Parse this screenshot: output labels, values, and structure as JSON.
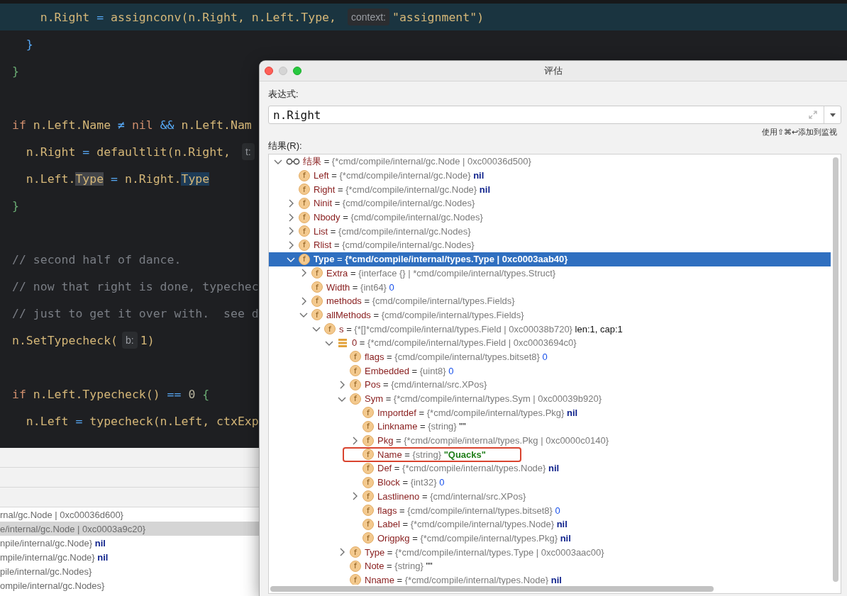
{
  "editor": {
    "lines": [
      {
        "kind": "code",
        "current": true,
        "segments": [
          {
            "text": "    n.Right ",
            "kind": "plain"
          },
          {
            "text": "= ",
            "kind": "op"
          },
          {
            "text": "assignconv(n.Right, n.Left.Type, ",
            "kind": "plain"
          },
          {
            "text": "context:",
            "kind": "hint"
          },
          {
            "text": "\"assignment\"",
            "kind": "string"
          },
          {
            "text": ")",
            "kind": "plain"
          }
        ]
      },
      {
        "kind": "code",
        "current": false,
        "segments": [
          {
            "text": "  }",
            "kind": "brace-inner"
          }
        ]
      },
      {
        "kind": "code",
        "current": false,
        "segments": [
          {
            "text": "}",
            "kind": "brace-outer"
          }
        ]
      },
      {
        "kind": "blank",
        "current": false
      },
      {
        "kind": "code",
        "current": false,
        "segments": [
          {
            "text": "if",
            "kind": "keyword"
          },
          {
            "text": " n.Left.Name ",
            "kind": "plain"
          },
          {
            "text": "≠ ",
            "kind": "op"
          },
          {
            "text": "nil ",
            "kind": "keyword"
          },
          {
            "text": "&& ",
            "kind": "op"
          },
          {
            "text": "n.Left.Nam",
            "kind": "plain"
          }
        ]
      },
      {
        "kind": "code",
        "current": false,
        "segments": [
          {
            "text": "  n.Right ",
            "kind": "plain"
          },
          {
            "text": "= ",
            "kind": "op"
          },
          {
            "text": "defaultlit(n.Right, ",
            "kind": "plain"
          },
          {
            "text": "t:",
            "kind": "hint"
          }
        ]
      },
      {
        "kind": "code",
        "current": false,
        "segments": [
          {
            "text": "  n.Left.",
            "kind": "plain"
          },
          {
            "text": "Type",
            "kind": "read-usage"
          },
          {
            "text": " = ",
            "kind": "op"
          },
          {
            "text": "n.Right.",
            "kind": "plain"
          },
          {
            "text": "Type",
            "kind": "write-usage"
          }
        ]
      },
      {
        "kind": "code",
        "current": false,
        "segments": [
          {
            "text": "}",
            "kind": "brace-outer"
          }
        ]
      },
      {
        "kind": "blank",
        "current": false
      },
      {
        "kind": "code",
        "current": false,
        "segments": [
          {
            "text": "// second half of dance.",
            "kind": "comment"
          }
        ]
      },
      {
        "kind": "code",
        "current": false,
        "segments": [
          {
            "text": "// now that right is done, typechec",
            "kind": "comment"
          }
        ]
      },
      {
        "kind": "code",
        "current": false,
        "segments": [
          {
            "text": "// just to get it over with.  see d",
            "kind": "comment"
          }
        ]
      },
      {
        "kind": "code",
        "current": false,
        "segments": [
          {
            "text": "n.SetTypecheck(",
            "kind": "plain"
          },
          {
            "text": "b:",
            "kind": "hint"
          },
          {
            "text": "1)",
            "kind": "plain"
          }
        ]
      },
      {
        "kind": "blank",
        "current": false
      },
      {
        "kind": "code",
        "current": false,
        "segments": [
          {
            "text": "if",
            "kind": "keyword"
          },
          {
            "text": " n.Left.Typecheck() ",
            "kind": "plain"
          },
          {
            "text": "== ",
            "kind": "op"
          },
          {
            "text": "0 ",
            "kind": "number"
          },
          {
            "text": "{",
            "kind": "brace-outer"
          }
        ]
      },
      {
        "kind": "code",
        "current": false,
        "segments": [
          {
            "text": "  n.Left ",
            "kind": "plain"
          },
          {
            "text": "= ",
            "kind": "op"
          },
          {
            "text": "typecheck(n.Left, ctxExp",
            "kind": "plain"
          }
        ]
      }
    ]
  },
  "variables_panel": {
    "rows": [
      {
        "text": "rnal/gc.Node | 0xc00036d600}",
        "selected": false
      },
      {
        "text": "e/internal/gc.Node | 0xc0003a9c20}",
        "selected": true
      },
      {
        "text": "npile/internal/gc.Node} ",
        "value": "nil",
        "selected": false
      },
      {
        "text": "mpile/internal/gc.Node} ",
        "value": "nil",
        "selected": false
      },
      {
        "text": "pile/internal/gc.Nodes}",
        "selected": false
      },
      {
        "text": "ompile/internal/gc.Nodes}",
        "selected": false
      }
    ]
  },
  "dialog": {
    "title": "评估",
    "window_buttons": [
      {
        "kind": "close",
        "disabled": false
      },
      {
        "kind": "minimize",
        "disabled": true
      },
      {
        "kind": "zoom",
        "disabled": false
      }
    ],
    "expression_label": "表达式:",
    "expression": "n.Right",
    "shortcut_hint": "使用⇧⌘↩添加到监视",
    "result_label": "结果(R):",
    "tree": {
      "nodes": [
        {
          "kind": "root",
          "name": "结果",
          "eq": "=",
          "type": "{*cmd/compile/internal/gc.Node | 0xc00036d500}",
          "expanded": true,
          "selected": false,
          "children": [
            {
              "kind": "field",
              "badge": "f",
              "name": "Left",
              "eq": "=",
              "type": "{*cmd/compile/internal/gc.Node}",
              "value": {
                "text": "nil",
                "kind": "nil"
              },
              "selected": false
            },
            {
              "kind": "field",
              "badge": "f",
              "name": "Right",
              "eq": "=",
              "type": "{*cmd/compile/internal/gc.Node}",
              "value": {
                "text": "nil",
                "kind": "nil"
              },
              "selected": false
            },
            {
              "kind": "field",
              "badge": "f",
              "name": "Ninit",
              "eq": "=",
              "type": "{cmd/compile/internal/gc.Nodes}",
              "expanded": false,
              "selected": false
            },
            {
              "kind": "field",
              "badge": "f",
              "name": "Nbody",
              "eq": "=",
              "type": "{cmd/compile/internal/gc.Nodes}",
              "expanded": false,
              "selected": false
            },
            {
              "kind": "field",
              "badge": "f",
              "name": "List",
              "eq": "=",
              "type": "{cmd/compile/internal/gc.Nodes}",
              "expanded": false,
              "selected": false
            },
            {
              "kind": "field",
              "badge": "f",
              "name": "Rlist",
              "eq": "=",
              "type": "{cmd/compile/internal/gc.Nodes}",
              "expanded": false,
              "selected": false
            },
            {
              "kind": "field",
              "badge": "f",
              "name": "Type",
              "eq": "=",
              "type": "{*cmd/compile/internal/types.Type | 0xc0003aab40}",
              "expanded": true,
              "selected": true,
              "children": [
                {
                  "kind": "field",
                  "badge": "f",
                  "name": "Extra",
                  "eq": "=",
                  "type": "{interface {} | *cmd/compile/internal/types.Struct}",
                  "expanded": false,
                  "selected": false
                },
                {
                  "kind": "field",
                  "badge": "f",
                  "name": "Width",
                  "eq": "=",
                  "type": "{int64}",
                  "value": {
                    "text": "0",
                    "kind": "number"
                  },
                  "selected": false
                },
                {
                  "kind": "field",
                  "badge": "f",
                  "name": "methods",
                  "eq": "=",
                  "type": "{cmd/compile/internal/types.Fields}",
                  "expanded": false,
                  "selected": false
                },
                {
                  "kind": "field",
                  "badge": "f",
                  "name": "allMethods",
                  "eq": "=",
                  "type": "{cmd/compile/internal/types.Fields}",
                  "expanded": true,
                  "selected": false,
                  "children": [
                    {
                      "kind": "field",
                      "badge": "f",
                      "name": "s",
                      "eq": "=",
                      "type": "{*[]*cmd/compile/internal/types.Field | 0xc00038b720}",
                      "value": {
                        "text": "len:1, cap:1",
                        "kind": "text"
                      },
                      "expanded": true,
                      "selected": false,
                      "children": [
                        {
                          "kind": "element",
                          "name": "0",
                          "eq": "=",
                          "type": "{*cmd/compile/internal/types.Field | 0xc0003694c0}",
                          "expanded": true,
                          "selected": false,
                          "children": [
                            {
                              "kind": "field",
                              "badge": "f",
                              "name": "flags",
                              "eq": "=",
                              "type": "{cmd/compile/internal/types.bitset8}",
                              "value": {
                                "text": "0",
                                "kind": "number"
                              },
                              "selected": false
                            },
                            {
                              "kind": "field",
                              "badge": "f",
                              "name": "Embedded",
                              "eq": "=",
                              "type": "{uint8}",
                              "value": {
                                "text": "0",
                                "kind": "number"
                              },
                              "selected": false
                            },
                            {
                              "kind": "field",
                              "badge": "f",
                              "name": "Pos",
                              "eq": "=",
                              "type": "{cmd/internal/src.XPos}",
                              "expanded": false,
                              "selected": false
                            },
                            {
                              "kind": "field",
                              "badge": "f",
                              "name": "Sym",
                              "eq": "=",
                              "type": "{*cmd/compile/internal/types.Sym | 0xc00039b920}",
                              "expanded": true,
                              "selected": false,
                              "children": [
                                {
                                  "kind": "field",
                                  "badge": "f",
                                  "name": "Importdef",
                                  "eq": "=",
                                  "type": "{*cmd/compile/internal/types.Pkg}",
                                  "value": {
                                    "text": "nil",
                                    "kind": "nil"
                                  },
                                  "selected": false,
                                  "highlighted": false
                                },
                                {
                                  "kind": "field",
                                  "badge": "f",
                                  "name": "Linkname",
                                  "eq": "=",
                                  "type": "{string}",
                                  "value": {
                                    "text": "\"\"",
                                    "kind": "text"
                                  },
                                  "selected": false,
                                  "highlighted": false
                                },
                                {
                                  "kind": "field",
                                  "badge": "f",
                                  "name": "Pkg",
                                  "eq": "=",
                                  "type": "{*cmd/compile/internal/types.Pkg | 0xc0000c0140}",
                                  "expanded": false,
                                  "selected": false,
                                  "highlighted": false
                                },
                                {
                                  "kind": "field",
                                  "badge": "f",
                                  "name": "Name",
                                  "eq": "=",
                                  "type": "{string}",
                                  "value": {
                                    "text": "\"Quacks\"",
                                    "kind": "string"
                                  },
                                  "selected": false,
                                  "highlighted": true
                                },
                                {
                                  "kind": "field",
                                  "badge": "f",
                                  "name": "Def",
                                  "eq": "=",
                                  "type": "{*cmd/compile/internal/types.Node}",
                                  "value": {
                                    "text": "nil",
                                    "kind": "nil"
                                  },
                                  "selected": false,
                                  "highlighted": false
                                },
                                {
                                  "kind": "field",
                                  "badge": "f",
                                  "name": "Block",
                                  "eq": "=",
                                  "type": "{int32}",
                                  "value": {
                                    "text": "0",
                                    "kind": "number"
                                  },
                                  "selected": false,
                                  "highlighted": false
                                },
                                {
                                  "kind": "field",
                                  "badge": "f",
                                  "name": "Lastlineno",
                                  "eq": "=",
                                  "type": "{cmd/internal/src.XPos}",
                                  "expanded": false,
                                  "selected": false,
                                  "highlighted": false
                                },
                                {
                                  "kind": "field",
                                  "badge": "f",
                                  "name": "flags",
                                  "eq": "=",
                                  "type": "{cmd/compile/internal/types.bitset8}",
                                  "value": {
                                    "text": "0",
                                    "kind": "number"
                                  },
                                  "selected": false,
                                  "highlighted": false
                                },
                                {
                                  "kind": "field",
                                  "badge": "f",
                                  "name": "Label",
                                  "eq": "=",
                                  "type": "{*cmd/compile/internal/types.Node}",
                                  "value": {
                                    "text": "nil",
                                    "kind": "nil"
                                  },
                                  "selected": false,
                                  "highlighted": false
                                },
                                {
                                  "kind": "field",
                                  "badge": "f",
                                  "name": "Origpkg",
                                  "eq": "=",
                                  "type": "{*cmd/compile/internal/types.Pkg}",
                                  "value": {
                                    "text": "nil",
                                    "kind": "nil"
                                  },
                                  "selected": false,
                                  "highlighted": false
                                }
                              ]
                            },
                            {
                              "kind": "field",
                              "badge": "f",
                              "name": "Type",
                              "eq": "=",
                              "type": "{*cmd/compile/internal/types.Type | 0xc0003aac00}",
                              "expanded": false,
                              "selected": false
                            },
                            {
                              "kind": "field",
                              "badge": "f",
                              "name": "Note",
                              "eq": "=",
                              "type": "{string}",
                              "value": {
                                "text": "\"\"",
                                "kind": "text"
                              },
                              "selected": false
                            },
                            {
                              "kind": "field",
                              "badge": "f",
                              "name": "Nname",
                              "eq": "=",
                              "type": "{*cmd/compile/internal/types.Node}",
                              "value": {
                                "text": "nil",
                                "kind": "nil"
                              },
                              "selected": false
                            }
                          ]
                        }
                      ]
                    }
                  ]
                }
              ]
            }
          ]
        }
      ]
    }
  }
}
